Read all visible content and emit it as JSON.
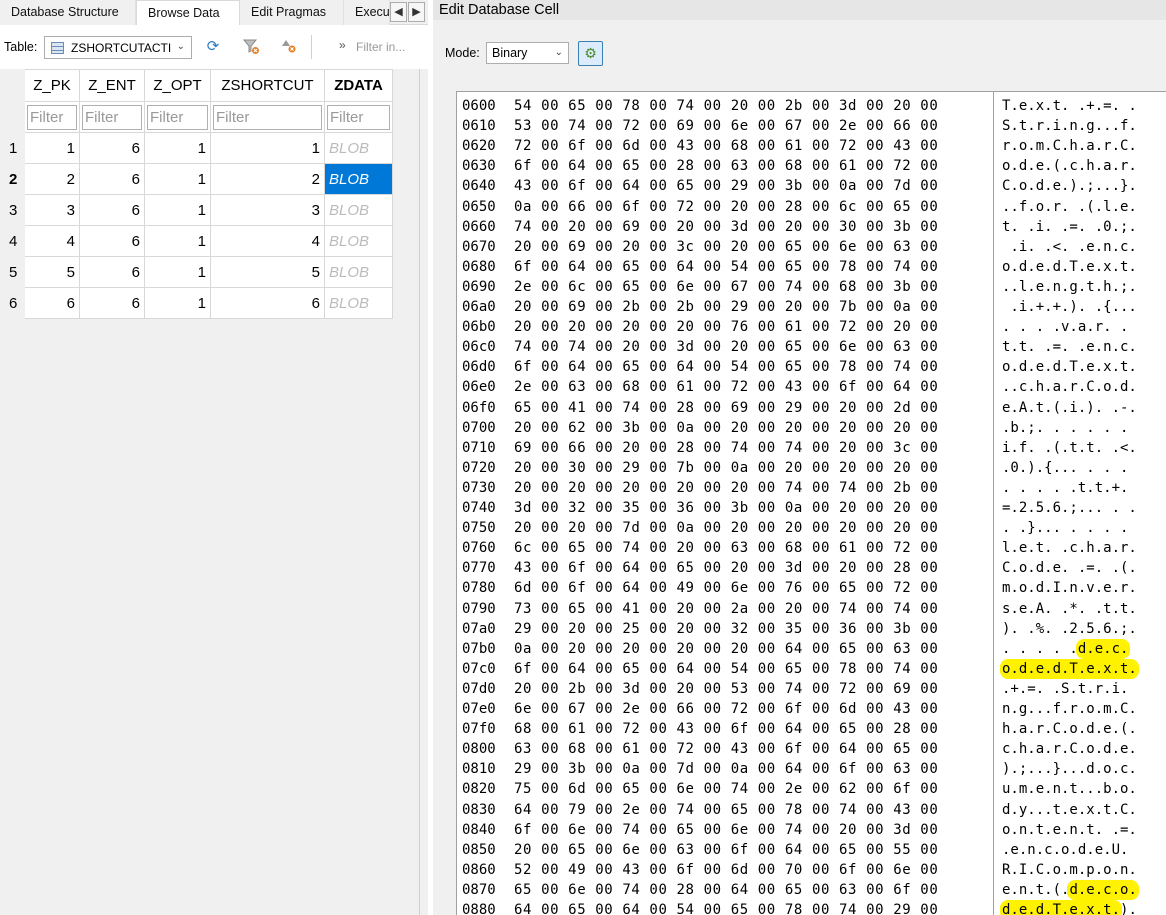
{
  "tabs": [
    "Database Structure",
    "Browse Data",
    "Edit Pragmas",
    "Execu"
  ],
  "tab_scroll": {
    "left": "◀",
    "right": "▶"
  },
  "toolbar": {
    "table_label": "Table:",
    "table_value": "ZSHORTCUTACTI",
    "filter_placeholder": "Filter in..."
  },
  "grid": {
    "columns": [
      "Z_PK",
      "Z_ENT",
      "Z_OPT",
      "ZSHORTCUT",
      "ZDATA"
    ],
    "filter_placeholder": "Filter",
    "rows": [
      {
        "n": "1",
        "z_pk": "1",
        "z_ent": "6",
        "z_opt": "1",
        "zshortcut": "1",
        "zdata": "BLOB"
      },
      {
        "n": "2",
        "z_pk": "2",
        "z_ent": "6",
        "z_opt": "1",
        "zshortcut": "2",
        "zdata": "BLOB"
      },
      {
        "n": "3",
        "z_pk": "3",
        "z_ent": "6",
        "z_opt": "1",
        "zshortcut": "3",
        "zdata": "BLOB"
      },
      {
        "n": "4",
        "z_pk": "4",
        "z_ent": "6",
        "z_opt": "1",
        "zshortcut": "4",
        "zdata": "BLOB"
      },
      {
        "n": "5",
        "z_pk": "5",
        "z_ent": "6",
        "z_opt": "1",
        "zshortcut": "5",
        "zdata": "BLOB"
      },
      {
        "n": "6",
        "z_pk": "6",
        "z_ent": "6",
        "z_opt": "1",
        "zshortcut": "6",
        "zdata": "BLOB"
      }
    ],
    "selected_row": 2
  },
  "cell_editor": {
    "title": "Edit Database Cell",
    "mode_label": "Mode:",
    "mode_value": "Binary",
    "highlight_color": "#fff200",
    "rows": [
      {
        "addr": "0600",
        "hex": "54 00 65 00 78 00 74 00 20 00 2b 00 3d 00 20 00",
        "ascii": "T.e.x.t. .+.=. ."
      },
      {
        "addr": "0610",
        "hex": "53 00 74 00 72 00 69 00 6e 00 67 00 2e 00 66 00",
        "ascii": "S.t.r.i.n.g...f."
      },
      {
        "addr": "0620",
        "hex": "72 00 6f 00 6d 00 43 00 68 00 61 00 72 00 43 00",
        "ascii": "r.o.m.C.h.a.r.C."
      },
      {
        "addr": "0630",
        "hex": "6f 00 64 00 65 00 28 00 63 00 68 00 61 00 72 00",
        "ascii": "o.d.e.(.c.h.a.r."
      },
      {
        "addr": "0640",
        "hex": "43 00 6f 00 64 00 65 00 29 00 3b 00 0a 00 7d 00",
        "ascii": "C.o.d.e.).;...}."
      },
      {
        "addr": "0650",
        "hex": "0a 00 66 00 6f 00 72 00 20 00 28 00 6c 00 65 00",
        "ascii": "..f.o.r. .(.l.e."
      },
      {
        "addr": "0660",
        "hex": "74 00 20 00 69 00 20 00 3d 00 20 00 30 00 3b 00",
        "ascii": "t. .i. .=. .0.;."
      },
      {
        "addr": "0670",
        "hex": "20 00 69 00 20 00 3c 00 20 00 65 00 6e 00 63 00",
        "ascii": " .i. .<. .e.n.c."
      },
      {
        "addr": "0680",
        "hex": "6f 00 64 00 65 00 64 00 54 00 65 00 78 00 74 00",
        "ascii": "o.d.e.d.T.e.x.t."
      },
      {
        "addr": "0690",
        "hex": "2e 00 6c 00 65 00 6e 00 67 00 74 00 68 00 3b 00",
        "ascii": "..l.e.n.g.t.h.;."
      },
      {
        "addr": "06a0",
        "hex": "20 00 69 00 2b 00 2b 00 29 00 20 00 7b 00 0a 00",
        "ascii": " .i.+.+.). .{..."
      },
      {
        "addr": "06b0",
        "hex": "20 00 20 00 20 00 20 00 76 00 61 00 72 00 20 00",
        "ascii": ". . . .v.a.r. ."
      },
      {
        "addr": "06c0",
        "hex": "74 00 74 00 20 00 3d 00 20 00 65 00 6e 00 63 00",
        "ascii": "t.t. .=. .e.n.c."
      },
      {
        "addr": "06d0",
        "hex": "6f 00 64 00 65 00 64 00 54 00 65 00 78 00 74 00",
        "ascii": "o.d.e.d.T.e.x.t."
      },
      {
        "addr": "06e0",
        "hex": "2e 00 63 00 68 00 61 00 72 00 43 00 6f 00 64 00",
        "ascii": "..c.h.a.r.C.o.d."
      },
      {
        "addr": "06f0",
        "hex": "65 00 41 00 74 00 28 00 69 00 29 00 20 00 2d 00",
        "ascii": "e.A.t.(.i.). .-."
      },
      {
        "addr": "0700",
        "hex": "20 00 62 00 3b 00 0a 00 20 00 20 00 20 00 20 00",
        "ascii": ".b.;. . . . . ."
      },
      {
        "addr": "0710",
        "hex": "69 00 66 00 20 00 28 00 74 00 74 00 20 00 3c 00",
        "ascii": "i.f. .(.t.t. .<."
      },
      {
        "addr": "0720",
        "hex": "20 00 30 00 29 00 7b 00 0a 00 20 00 20 00 20 00",
        "ascii": ".0.).{... . . ."
      },
      {
        "addr": "0730",
        "hex": "20 00 20 00 20 00 20 00 20 00 74 00 74 00 2b 00",
        "ascii": ". . . . .t.t.+."
      },
      {
        "addr": "0740",
        "hex": "3d 00 32 00 35 00 36 00 3b 00 0a 00 20 00 20 00",
        "ascii": "=.2.5.6.;... . ."
      },
      {
        "addr": "0750",
        "hex": "20 00 20 00 7d 00 0a 00 20 00 20 00 20 00 20 00",
        "ascii": ". .}... . . . ."
      },
      {
        "addr": "0760",
        "hex": "6c 00 65 00 74 00 20 00 63 00 68 00 61 00 72 00",
        "ascii": "l.e.t. .c.h.a.r."
      },
      {
        "addr": "0770",
        "hex": "43 00 6f 00 64 00 65 00 20 00 3d 00 20 00 28 00",
        "ascii": "C.o.d.e. .=. .(."
      },
      {
        "addr": "0780",
        "hex": "6d 00 6f 00 64 00 49 00 6e 00 76 00 65 00 72 00",
        "ascii": "m.o.d.I.n.v.e.r."
      },
      {
        "addr": "0790",
        "hex": "73 00 65 00 41 00 20 00 2a 00 20 00 74 00 74 00",
        "ascii": "s.e.A. .*. .t.t."
      },
      {
        "addr": "07a0",
        "hex": "29 00 20 00 25 00 20 00 32 00 35 00 36 00 3b 00",
        "ascii": "). .%. .2.5.6.;."
      },
      {
        "addr": "07b0",
        "hex": "0a 00 20 00 20 00 20 00 20 00 64 00 65 00 63 00",
        "ascii": ". . . . .d.e.c."
      },
      {
        "addr": "07c0",
        "hex": "6f 00 64 00 65 00 64 00 54 00 65 00 78 00 74 00",
        "ascii": "o.d.e.d.T.e.x.t."
      },
      {
        "addr": "07d0",
        "hex": "20 00 2b 00 3d 00 20 00 53 00 74 00 72 00 69 00",
        "ascii": ".+.=. .S.t.r.i."
      },
      {
        "addr": "07e0",
        "hex": "6e 00 67 00 2e 00 66 00 72 00 6f 00 6d 00 43 00",
        "ascii": "n.g...f.r.o.m.C."
      },
      {
        "addr": "07f0",
        "hex": "68 00 61 00 72 00 43 00 6f 00 64 00 65 00 28 00",
        "ascii": "h.a.r.C.o.d.e.(."
      },
      {
        "addr": "0800",
        "hex": "63 00 68 00 61 00 72 00 43 00 6f 00 64 00 65 00",
        "ascii": "c.h.a.r.C.o.d.e."
      },
      {
        "addr": "0810",
        "hex": "29 00 3b 00 0a 00 7d 00 0a 00 64 00 6f 00 63 00",
        "ascii": ").;...}...d.o.c."
      },
      {
        "addr": "0820",
        "hex": "75 00 6d 00 65 00 6e 00 74 00 2e 00 62 00 6f 00",
        "ascii": "u.m.e.n.t...b.o."
      },
      {
        "addr": "0830",
        "hex": "64 00 79 00 2e 00 74 00 65 00 78 00 74 00 43 00",
        "ascii": "d.y...t.e.x.t.C."
      },
      {
        "addr": "0840",
        "hex": "6f 00 6e 00 74 00 65 00 6e 00 74 00 20 00 3d 00",
        "ascii": "o.n.t.e.n.t. .=."
      },
      {
        "addr": "0850",
        "hex": "20 00 65 00 6e 00 63 00 6f 00 64 00 65 00 55 00",
        "ascii": ".e.n.c.o.d.e.U."
      },
      {
        "addr": "0860",
        "hex": "52 00 49 00 43 00 6f 00 6d 00 70 00 6f 00 6e 00",
        "ascii": "R.I.C.o.m.p.o.n."
      },
      {
        "addr": "0870",
        "hex": "65 00 6e 00 74 00 28 00 64 00 65 00 63 00 6f 00",
        "ascii": "e.n.t.(.d.e.c.o."
      },
      {
        "addr": "0880",
        "hex": "64 00 65 00 64 00 54 00 65 00 78 00 74 00 29 00",
        "ascii": "d.e.d.T.e.x.t.)."
      }
    ],
    "highlights": [
      {
        "row": 27,
        "start": 9,
        "end": 15
      },
      {
        "row": 28,
        "start": 0,
        "end": 16
      },
      {
        "row": 39,
        "start": 8,
        "end": 16
      },
      {
        "row": 40,
        "start": 0,
        "end": 14
      }
    ]
  }
}
